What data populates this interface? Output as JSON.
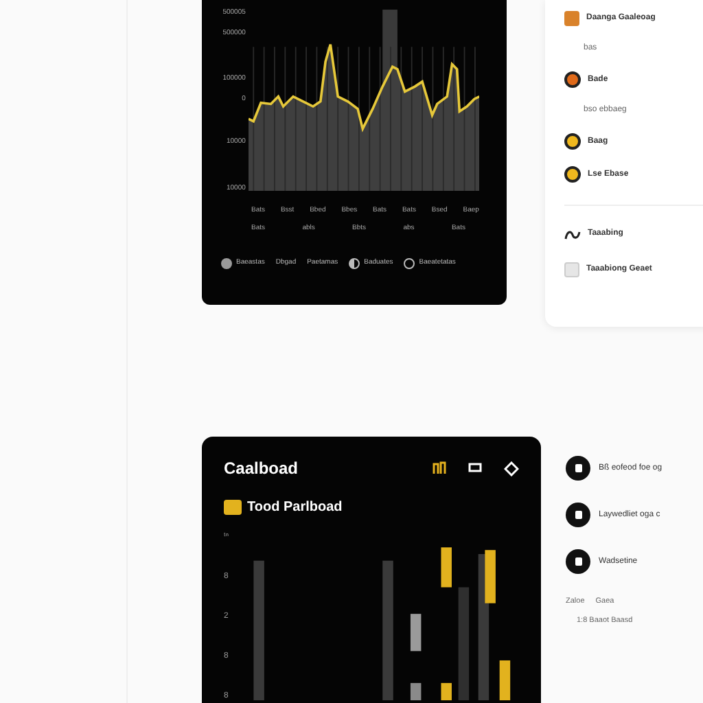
{
  "trend_card": {
    "y_labels": [
      "500005",
      "500000",
      "100000",
      "0",
      "10000",
      "10000"
    ],
    "x_labels": [
      "Bats",
      "Bsst",
      "Bbed",
      "Bbes",
      "Bats",
      "Bats",
      "Bsed",
      "Baep"
    ],
    "x_sublabels": [
      "Bats",
      "abls",
      "Bbts",
      "abs",
      "Bats"
    ],
    "legend": [
      {
        "label": "Baeastas",
        "kind": "dot"
      },
      {
        "label": "Dbgad",
        "kind": "none"
      },
      {
        "label": "Paetamas",
        "kind": "none"
      },
      {
        "label": "Baduates",
        "kind": "half"
      },
      {
        "label": "Baeatetatas",
        "kind": "ring"
      }
    ]
  },
  "side_list": {
    "items": [
      {
        "label": "Daanga Gaaleoag",
        "kind": "badge"
      },
      {
        "label": "bas",
        "kind": "sub"
      },
      {
        "label": "Bade",
        "kind": "orange"
      },
      {
        "label": "bso ebbaeg",
        "kind": "sub"
      },
      {
        "label": "Baag",
        "kind": "yellow"
      },
      {
        "label": "Lse Ebase",
        "kind": "yellow"
      }
    ],
    "footer": [
      {
        "label": "Taaabing",
        "kind": "wave"
      },
      {
        "label": "Taaabiong Geaet",
        "kind": "tile"
      }
    ]
  },
  "board_card": {
    "title": "Caalboad",
    "subtitle": "Tood Parlboad",
    "y_labels": [
      "ᵗⁿ",
      "8",
      "2",
      "8",
      "8"
    ]
  },
  "activity": {
    "items": [
      {
        "label": "Bß eofeod foe og"
      },
      {
        "label": "Laywedliet oga c"
      },
      {
        "label": "Wadsetine"
      }
    ],
    "meta": [
      "Zaloe",
      "Gaea"
    ],
    "note": "1:8 Baaot Baasd"
  }
}
